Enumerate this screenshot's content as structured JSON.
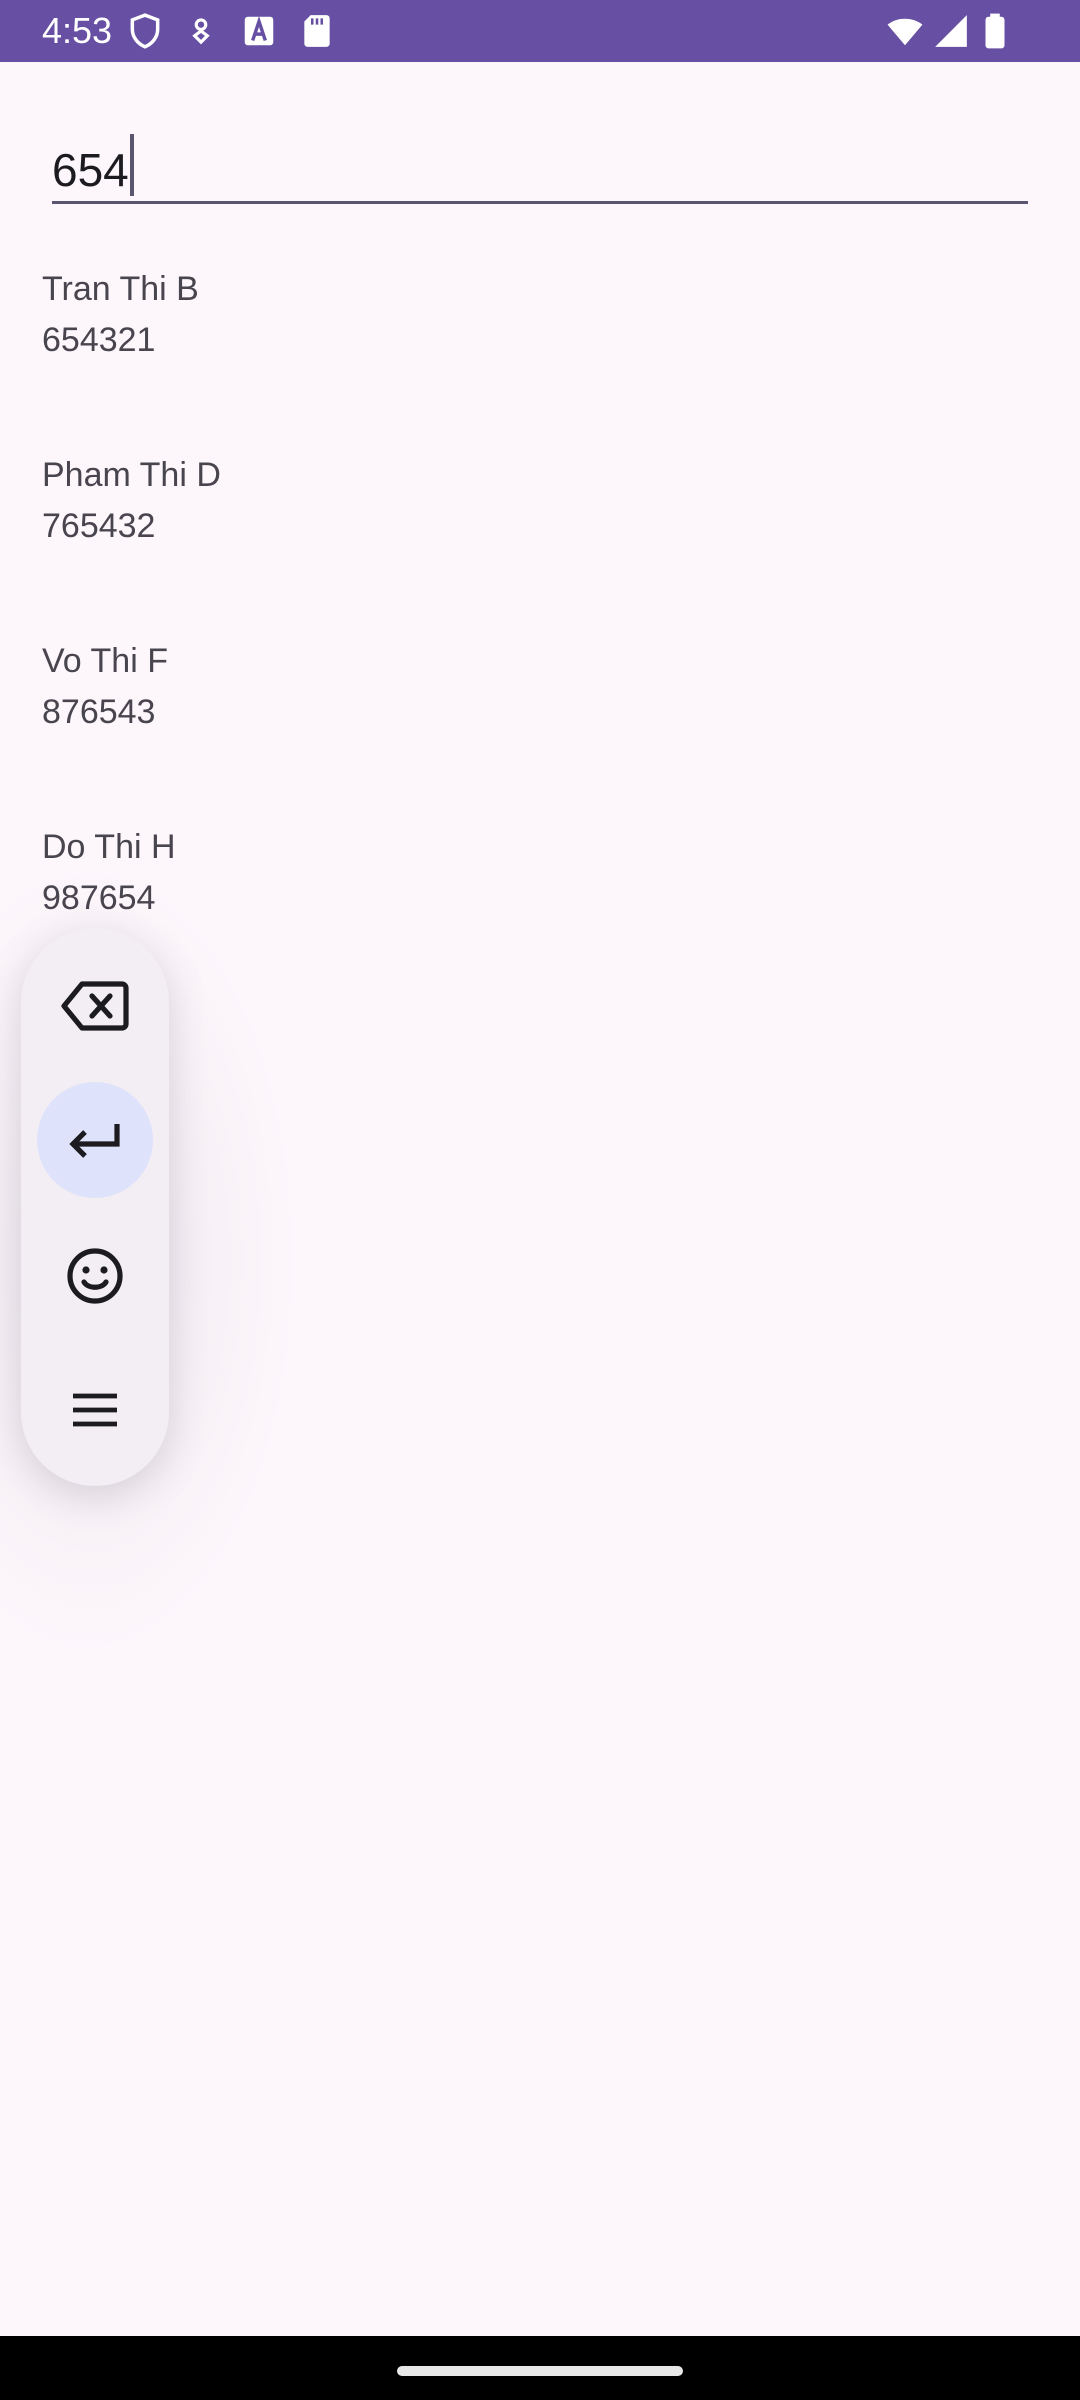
{
  "status_bar": {
    "time": "4:53",
    "left_icons": [
      "shield-icon",
      "dog-icon",
      "text-a-icon",
      "sd-card-icon"
    ],
    "right_icons": [
      "wifi-icon",
      "signal-icon",
      "battery-icon"
    ],
    "background": "#6750a4"
  },
  "search": {
    "value": "654"
  },
  "results": [
    {
      "name": "Tran Thi B",
      "number": "654321"
    },
    {
      "name": "Pham Thi D",
      "number": "765432"
    },
    {
      "name": "Vo Thi F",
      "number": "876543"
    },
    {
      "name": "Do Thi H",
      "number": "987654"
    }
  ],
  "floating_toolbar": {
    "buttons": [
      "backspace-icon",
      "enter-icon",
      "emoji-icon",
      "menu-icon"
    ],
    "active_button": "enter-icon",
    "active_color": "#dfe2fb"
  },
  "colors": {
    "background": "#fdf7fc",
    "text": "#49454f",
    "underline": "#5b5670"
  }
}
